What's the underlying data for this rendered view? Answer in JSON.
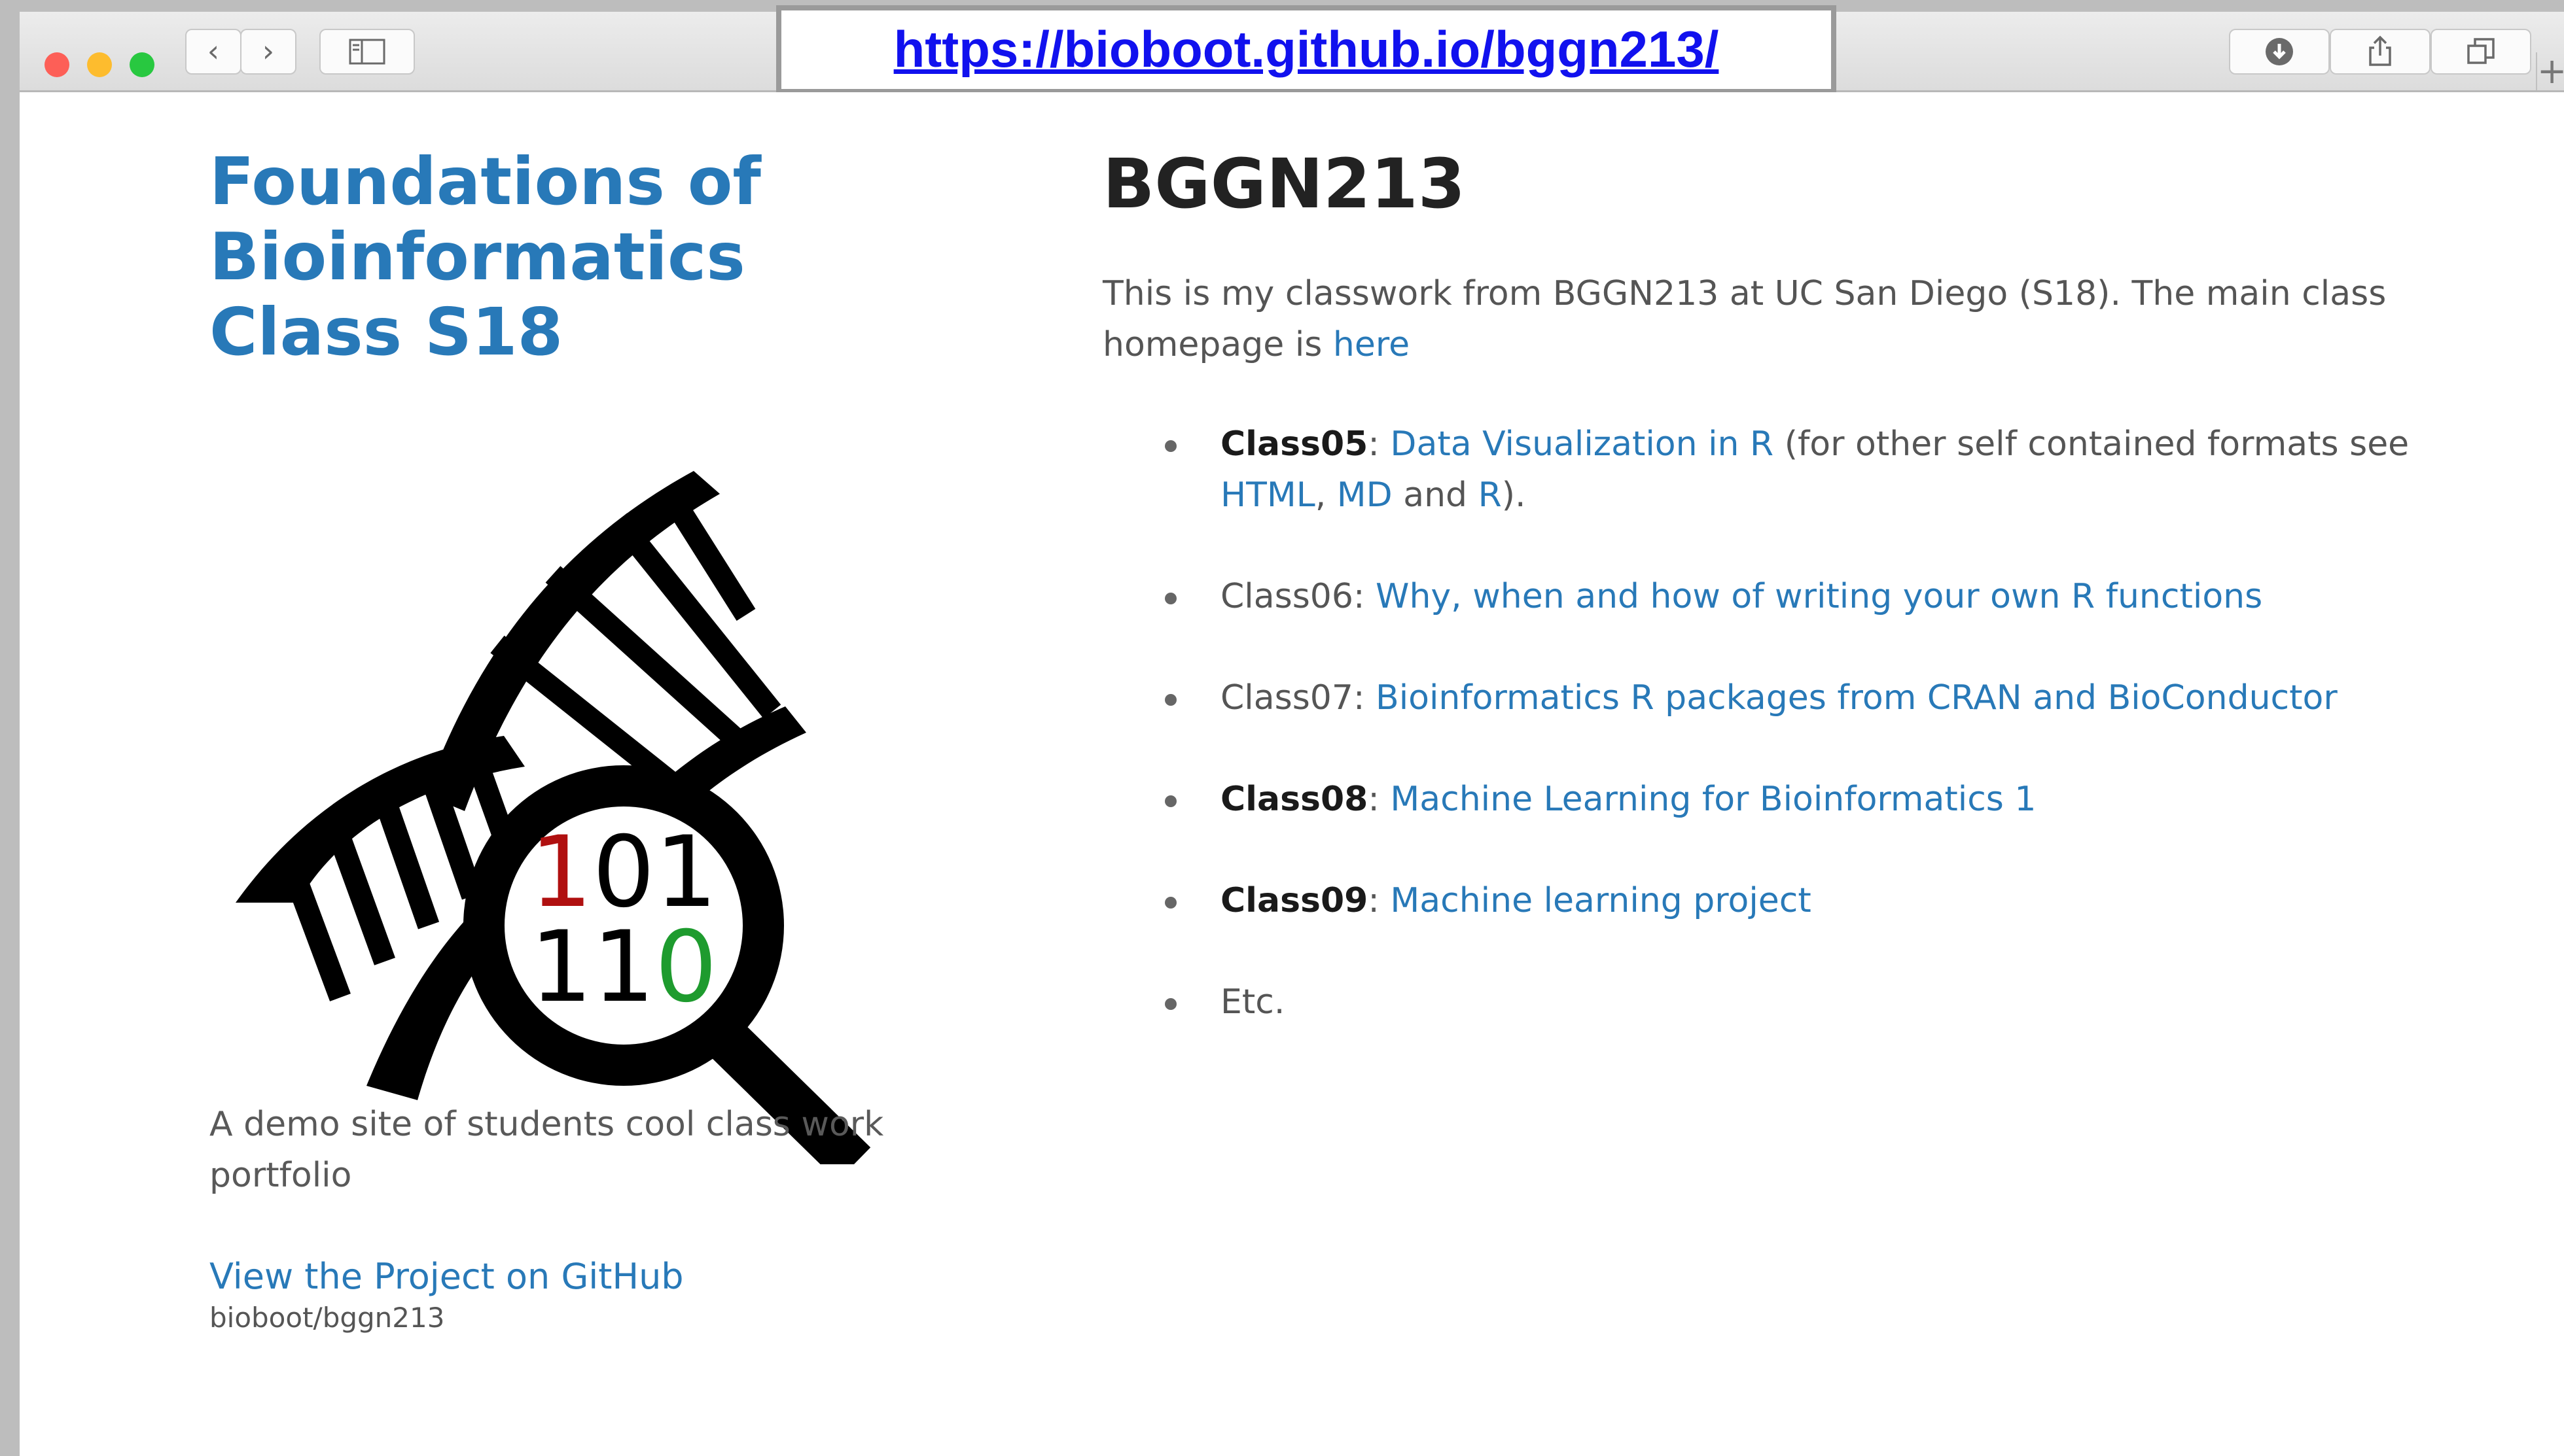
{
  "browser": {
    "url": "https://bioboot.github.io/bggn213/",
    "back_icon": "‹",
    "forward_icon": "›",
    "colors": {
      "close": "#fd5f57",
      "minimize": "#fdbc2e",
      "maximize": "#28c840",
      "url_text": "#1111ee"
    }
  },
  "sidebar": {
    "title_lines": [
      "Foundations of",
      "Bioinformatics",
      "Class S18"
    ],
    "logo": {
      "digits_line1": [
        "1",
        "01"
      ],
      "digits_line2": [
        "11",
        "0"
      ],
      "accent_red": "#b01010",
      "accent_green": "#1e9b2e"
    },
    "tagline": "A demo site of students cool class work portfolio",
    "github_link": "View the Project on GitHub",
    "github_repo": "bioboot/bggn213"
  },
  "main": {
    "heading": "BGGN213",
    "intro_text": "This is my classwork from BGGN213 at UC San Diego (S18). The main class homepage is",
    "intro_link": "here",
    "items": [
      {
        "label": "Class05",
        "sep": ":",
        "link": "Data Visualization in R",
        "rest": "(for other self contained formats see",
        "link2": "HTML",
        "comma": ",",
        "link3": "MD",
        "and": "and",
        "link4": "R",
        "end": ")."
      },
      {
        "label": "Class06:",
        "link": "Why, when and how of writing your own R functions"
      },
      {
        "label": "Class07:",
        "link": "Bioinformatics R packages from CRAN and BioConductor"
      },
      {
        "label": "Class08",
        "sep": ":",
        "link": "Machine Learning for Bioinformatics 1"
      },
      {
        "label": "Class09",
        "sep": ":",
        "link": "Machine learning project"
      },
      {
        "label": "Etc."
      }
    ],
    "link_color": "#2879b8"
  }
}
